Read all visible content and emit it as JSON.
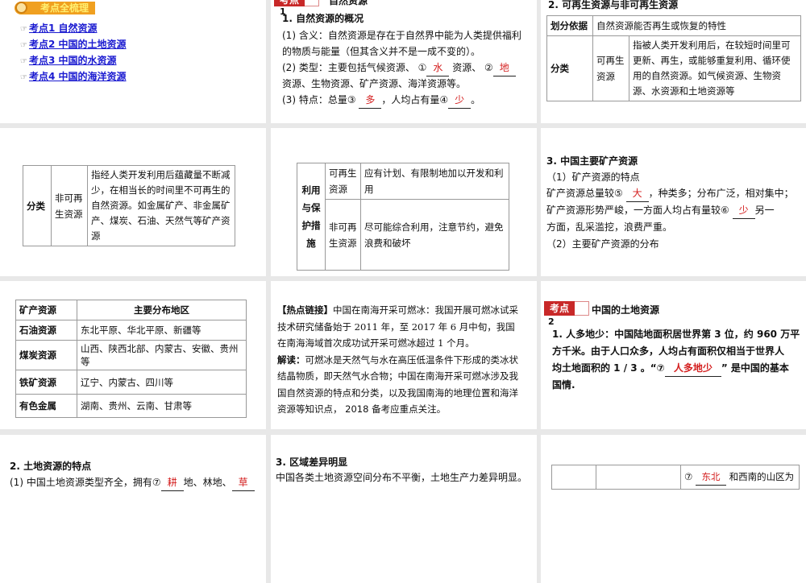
{
  "s1": {
    "banner": "考点全梳理",
    "links": [
      "考点1  自然资源",
      "考点2  中国的土地资源",
      "考点3  中国的水资源",
      "考点4  中国的海洋资源"
    ],
    "bullet": "☞"
  },
  "s2": {
    "tag": "考点",
    "tag_num": "1",
    "title": "自然资源",
    "heading": "1. 自然资源的概况",
    "l1": "(1) 含义：自然资源是存在于自然界中能为人类提供福利",
    "l2": "的物质与能量（但其含义并不是一成不变的）。",
    "l3a": "(2) 类型：主要包括气候资源、 ①",
    "a1": "水",
    "l3b": " 资源、 ②",
    "a2": "地",
    "l4": "资源、生物资源、矿产资源、海洋资源等。",
    "l5a": "(3) 特点：总量③ ",
    "a3": "多",
    "l5b": "，人均占有量④",
    "a4": "少",
    "l5c": "。"
  },
  "s3": {
    "heading": "2. 可再生资源与非可再生资源",
    "r1c1": "划分依据",
    "r1c2": "自然资源能否再生或恢复的特性",
    "r2c1": "分类",
    "r2c2": "可再生资源",
    "r2c3": "指被人类开发利用后，在较短时间里可更新、再生，或能够重复利用、循环使用的自然资源。如气候资源、生物资源、水资源和土地资源等"
  },
  "s4": {
    "c1": "分类",
    "c2": "非可再生资源",
    "c3": "指经人类开发利用后蕴藏量不断减少，在相当长的时间里不可再生的自然资源。如金属矿产、非金属矿产、煤炭、石油、天然气等矿产资源"
  },
  "s5": {
    "c1": "利用与保护措施",
    "r1c2": "可再生资源",
    "r1c3": "应有计划、有限制地加以开发和利用",
    "r2c2": "非可再生资源",
    "r2c3": "尽可能综合利用，注意节约，避免浪费和破坏"
  },
  "s6": {
    "heading": "3. 中国主要矿产资源",
    "sub1": "（1）矿产资源的特点",
    "l1a": "矿产资源总量较⑤ ",
    "a5": "大",
    "l1b": "，种类多；分布广泛，相对集中；",
    "l2a": "矿产资源形势严峻，一方面人均占有量较⑥ ",
    "a6": "少",
    "l2b": "另一",
    "l3": "方面，乱采滥挖，浪费严重。",
    "sub2": "（2）主要矿产资源的分布"
  },
  "s7": {
    "headers": [
      "矿产资源",
      "主要分布地区"
    ],
    "rows": [
      [
        "石油资源",
        "东北平原、华北平原、新疆等"
      ],
      [
        "煤炭资源",
        "山西、陕西北部、内蒙古、安徽、贵州等"
      ],
      [
        "铁矿资源",
        "辽宁、内蒙古、四川等"
      ],
      [
        "有色金属",
        "湖南、贵州、云南、甘肃等"
      ]
    ]
  },
  "s8": {
    "label": "【热点链接】",
    "p1": "中国在南海开采可燃冰：我国开展可燃冰试采技术研究储备始于 2011 年，至 2017 年 6 月中旬，我国在南海海域首次成功试开采可燃冰超过 1 个月。",
    "label2": "解读：",
    "p2": "可燃冰是天然气与水在高压低温条件下形成的类冰状结晶物质，即天然气水合物；中国在南海开采可燃冰涉及我国自然资源的特点和分类，以及我国南海的地理位置和海洋资源等知识点， 2018 备考应重点关注。"
  },
  "s9": {
    "tag": "考点",
    "tag_num": "2",
    "title": "中国的土地资源",
    "l1": "1. 人多地少：中国陆地面积居世界第 3 位，约 960 万平",
    "l2": "方千米。由于人口众多，人均占有面积仅相当于世界人",
    "l3a": "均土地面积的 1 / 3 。“⑦",
    "a7": "人多地少",
    "l3b": "” 是中国的基本",
    "l4": "国情."
  },
  "s10": {
    "heading": "2. 土地资源的特点",
    "l1a": "(1) 中国土地资源类型齐全，拥有⑦",
    "a": "耕",
    "l1b": "地、林地、",
    "a2": "草"
  },
  "s11": {
    "heading": "3. 区域差异明显",
    "l1": "中国各类土地资源空间分布不平衡，土地生产力差异明显。"
  },
  "s12": {
    "pre": "⑦ ",
    "a": "东北",
    "post": " 和西南的山区为"
  }
}
